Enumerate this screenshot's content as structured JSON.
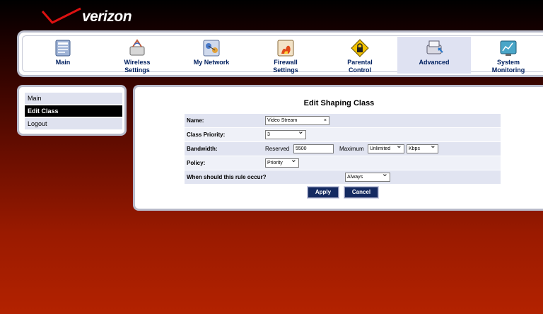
{
  "brand": {
    "name": "verizon"
  },
  "nav": {
    "items": [
      {
        "label_line1": "Main",
        "label_line2": "",
        "icon": "main-icon"
      },
      {
        "label_line1": "Wireless",
        "label_line2": "Settings",
        "icon": "wireless-icon"
      },
      {
        "label_line1": "My Network",
        "label_line2": "",
        "icon": "network-icon"
      },
      {
        "label_line1": "Firewall",
        "label_line2": "Settings",
        "icon": "firewall-icon"
      },
      {
        "label_line1": "Parental",
        "label_line2": "Control",
        "icon": "lock-icon"
      },
      {
        "label_line1": "Advanced",
        "label_line2": "",
        "icon": "advanced-icon"
      },
      {
        "label_line1": "System",
        "label_line2": "Monitoring",
        "icon": "monitor-icon"
      }
    ],
    "active": "Advanced"
  },
  "sidebar": {
    "items": [
      {
        "label": "Main"
      },
      {
        "label": "Edit Class"
      },
      {
        "label": "Logout"
      }
    ],
    "active": "Edit Class"
  },
  "form": {
    "title": "Edit Shaping Class",
    "name_label": "Name:",
    "name_value": "Video Stream",
    "clear_symbol": "×",
    "priority_label": "Class Priority:",
    "priority_value": "3",
    "bandwidth_label": "Bandwidth:",
    "reserved_label": "Reserved",
    "reserved_value": "5500",
    "maximum_label": "Maximum",
    "maximum_value": "Unlimited",
    "unit_value": "Kbps",
    "policy_label": "Policy:",
    "policy_value": "Priority",
    "when_label": "When should this rule occur?",
    "when_value": "Always",
    "apply_label": "Apply",
    "cancel_label": "Cancel"
  },
  "colors": {
    "accent": "#142a61",
    "nav_active": "#dfe2f2",
    "row_a": "#e1e4f1",
    "row_b": "#eff1f8",
    "frame": "#b9bccb"
  }
}
